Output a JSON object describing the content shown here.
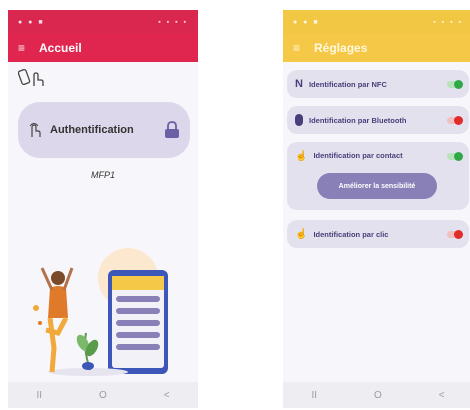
{
  "screen1": {
    "status": {
      "left": "● ● ■",
      "right": "▪ ▪ ▪ ▪"
    },
    "appbar": {
      "menu_icon": "≡",
      "title": "Accueil"
    },
    "top_icons": {
      "phone_icon": "📱",
      "hand_icon": "☝"
    },
    "auth": {
      "hand_icon": "☝",
      "label": "Authentification",
      "lock_icon": "lock"
    },
    "device_label": "MFP1",
    "nav": {
      "recent": "II",
      "home": "O",
      "back": "<"
    }
  },
  "screen2": {
    "status": {
      "left": "● ● ■",
      "right": "▪ ▪ ▪ ▪"
    },
    "appbar": {
      "menu_icon": "≡",
      "title": "Réglages"
    },
    "settings": [
      {
        "label": "Identification par NFC",
        "icon": "N",
        "state": "on"
      },
      {
        "label": "Identification par Bluetooth",
        "icon": "ʙ",
        "state": "off"
      },
      {
        "label": "Identification par contact",
        "icon": "☝",
        "state": "on"
      },
      {
        "label": "Identification par clic",
        "icon": "☝",
        "state": "off"
      }
    ],
    "sensitivity_button": "Améliorer la sensibilité",
    "nav": {
      "recent": "II",
      "home": "O",
      "back": "<"
    }
  },
  "colors": {
    "accent_red": "#e0254f",
    "accent_yellow": "#f5c947",
    "card": "#dcd7ea",
    "toggle_on": "#2fa84a",
    "toggle_off": "#e02b2b"
  }
}
